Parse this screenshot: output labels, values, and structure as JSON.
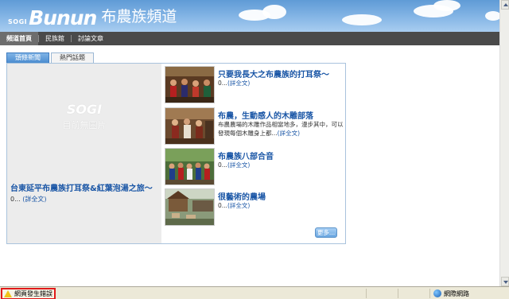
{
  "header": {
    "logo_sogi": "SOGI",
    "logo_bunun": "Bunun",
    "site_title": "布農族頻道"
  },
  "nav": {
    "items": [
      {
        "label": "頻道首頁",
        "active": true
      },
      {
        "label": "民族館",
        "active": false
      },
      {
        "label": "討論文章",
        "active": false
      }
    ]
  },
  "tabs": [
    {
      "label": "頭條新聞",
      "active": true
    },
    {
      "label": "熱門話題",
      "active": false
    }
  ],
  "featured": {
    "noimage_logo": "SOGI",
    "noimage_text": "目前無圖片",
    "title": "台東延平布農族打耳祭&紅葉泡湯之旅～",
    "desc_prefix": "0...",
    "more_label": "(詳全文)"
  },
  "news": [
    {
      "title": "只要我長大之布農族的打耳祭～",
      "desc": "0...",
      "more_label": "(詳全文)",
      "icon": "photo-festival"
    },
    {
      "title": "布農，生動感人的木雕部落",
      "desc": "布農農場的木雕作品相當地多，漫步其中，可以發現每個木雕身上都...",
      "more_label": "(詳全文)",
      "icon": "photo-woodcarving"
    },
    {
      "title": "布農族八部合音",
      "desc": "0...",
      "more_label": "(詳全文)",
      "icon": "photo-choir"
    },
    {
      "title": "很藝術的農場",
      "desc": "0...",
      "more_label": "(詳全文)",
      "icon": "photo-farm"
    }
  ],
  "more_button": "更多...",
  "statusbar": {
    "error_text": "網頁發生錯誤",
    "zone_text": "網際網路"
  },
  "colors": {
    "banner": "#6ea6dd",
    "nav": "#4a4a4a",
    "link": "#1a56a6",
    "error_border": "#e01919"
  }
}
